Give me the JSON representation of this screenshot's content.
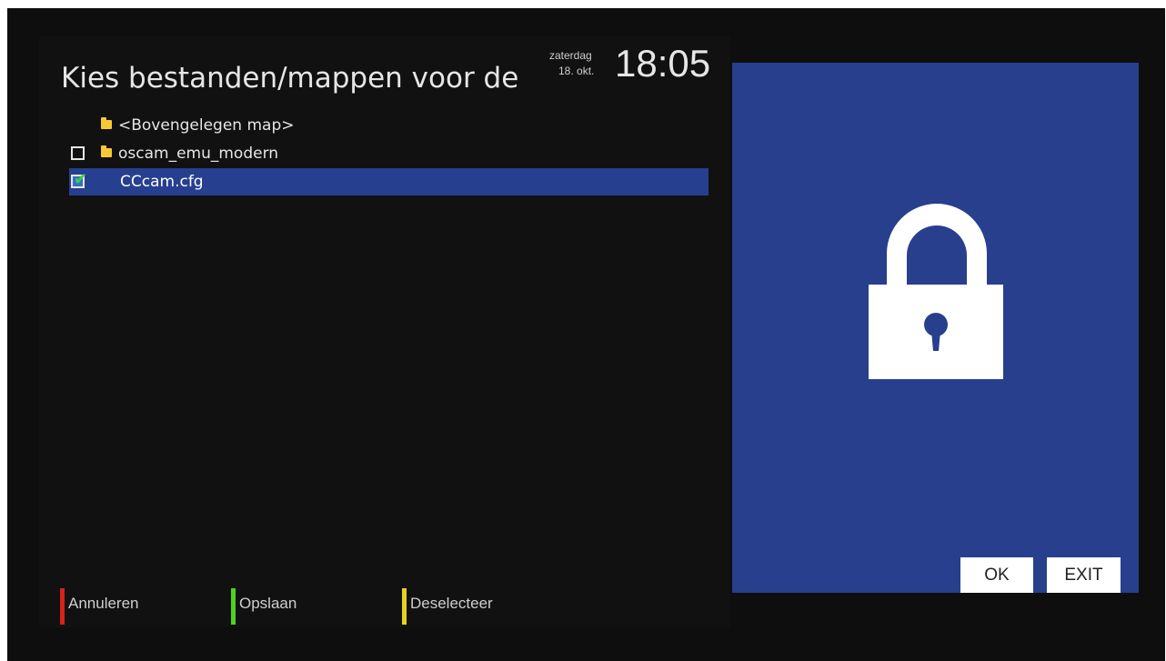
{
  "header": {
    "title": "Kies bestanden/mappen voor de back-up",
    "date_day": "zaterdag",
    "date_num": "18. okt.",
    "clock": "18:05"
  },
  "file_list": {
    "items": [
      {
        "label": "<Bovengelegen map>",
        "type": "folder",
        "checked": null,
        "selected": false
      },
      {
        "label": "oscam_emu_modern",
        "type": "folder",
        "checked": false,
        "selected": false
      },
      {
        "label": "CCcam.cfg",
        "type": "file",
        "checked": true,
        "selected": true
      }
    ]
  },
  "color_buttons": {
    "red": "Annuleren",
    "green": "Opslaan",
    "yellow": "Deselecteer"
  },
  "dialog": {
    "icon": "lock-icon",
    "ok_label": "OK",
    "exit_label": "EXIT"
  },
  "colors": {
    "selection": "#263f8f",
    "panel_blue": "#273f8d",
    "red": "#d8221a",
    "green": "#4fd21e",
    "yellow": "#e6d21c"
  }
}
